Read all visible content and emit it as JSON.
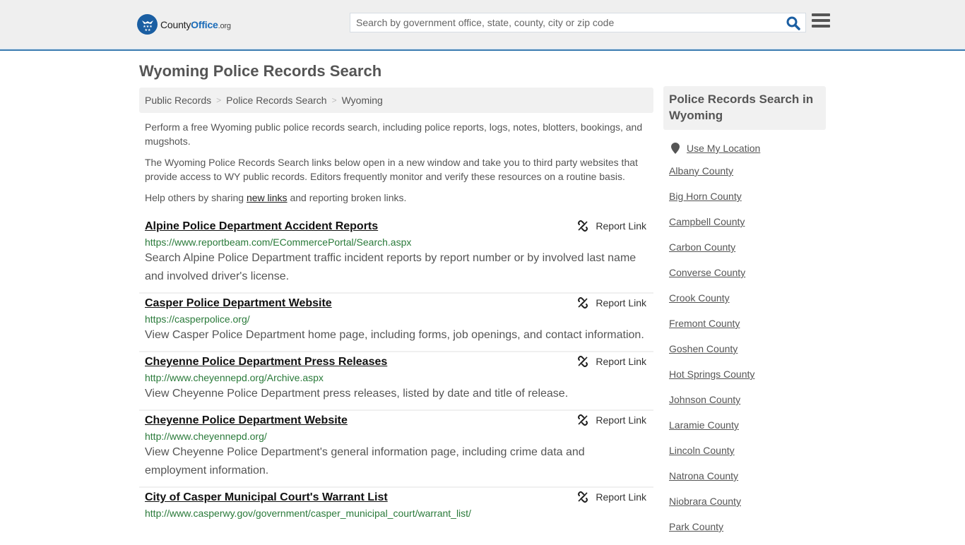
{
  "header": {
    "logo": {
      "name": "County",
      "name_bold": "Office",
      "tld": ".org"
    },
    "search": {
      "placeholder": "Search by government office, state, county, city or zip code",
      "value": ""
    },
    "colors": {
      "brand": "#1a5ea2",
      "accent_border": "#3a7bb0"
    }
  },
  "page": {
    "title": "Wyoming Police Records Search"
  },
  "breadcrumb": [
    {
      "label": "Public Records"
    },
    {
      "label": "Police Records Search"
    },
    {
      "label": "Wyoming"
    }
  ],
  "intro": {
    "p1": "Perform a free Wyoming public police records search, including police reports, logs, notes, blotters, bookings, and mugshots.",
    "p2": "The Wyoming Police Records Search links below open in a new window and take you to third party websites that provide access to WY public records. Editors frequently monitor and verify these resources on a routine basis.",
    "p3_before": "Help others by sharing ",
    "p3_link": "new links",
    "p3_after": " and reporting broken links."
  },
  "results": [
    {
      "title": "Alpine Police Department Accident Reports",
      "url": "https://www.reportbeam.com/ECommercePortal/Search.aspx",
      "description": "Search Alpine Police Department traffic incident reports by report number or by involved last name and involved driver's license.",
      "report_label": "Report Link"
    },
    {
      "title": "Casper Police Department Website",
      "url": "https://casperpolice.org/",
      "description": "View Casper Police Department home page, including forms, job openings, and contact information.",
      "report_label": "Report Link"
    },
    {
      "title": "Cheyenne Police Department Press Releases",
      "url": "http://www.cheyennepd.org/Archive.aspx",
      "description": "View Cheyenne Police Department press releases, listed by date and title of release.",
      "report_label": "Report Link"
    },
    {
      "title": "Cheyenne Police Department Website",
      "url": "http://www.cheyennepd.org/",
      "description": "View Cheyenne Police Department's general information page, including crime data and employment information.",
      "report_label": "Report Link"
    },
    {
      "title": "City of Casper Municipal Court's Warrant List",
      "url": "http://www.casperwy.gov/government/casper_municipal_court/warrant_list/",
      "description": "",
      "report_label": "Report Link"
    }
  ],
  "sidebar": {
    "heading": "Police Records Search in Wyoming",
    "use_location": "Use My Location",
    "counties": [
      "Albany County",
      "Big Horn County",
      "Campbell County",
      "Carbon County",
      "Converse County",
      "Crook County",
      "Fremont County",
      "Goshen County",
      "Hot Springs County",
      "Johnson County",
      "Laramie County",
      "Lincoln County",
      "Natrona County",
      "Niobrara County",
      "Park County"
    ]
  }
}
